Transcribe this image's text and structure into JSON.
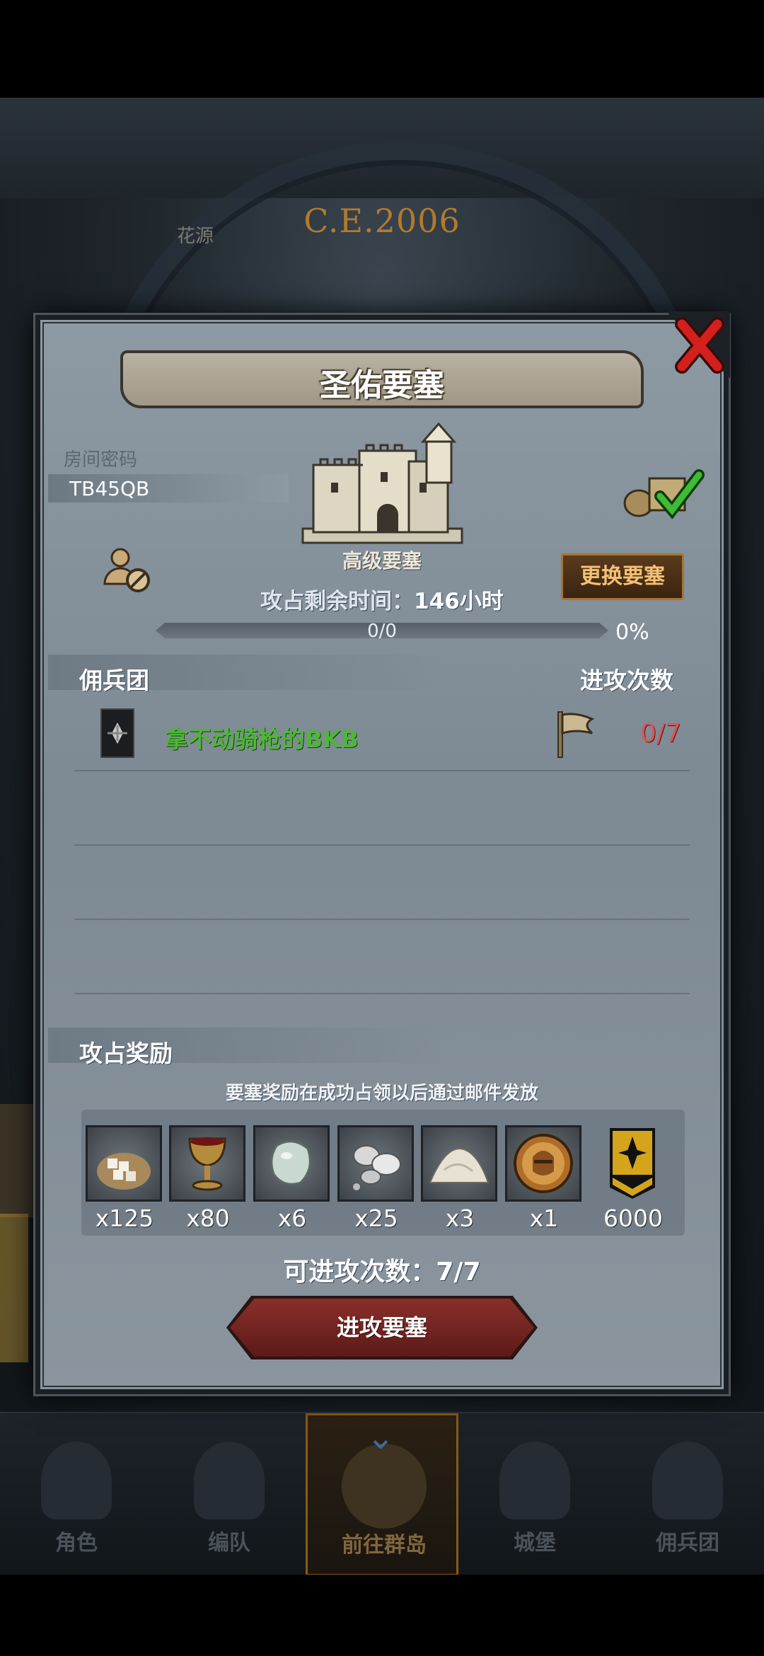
{
  "background": {
    "era_label": "C.E.2006",
    "map_text": "花源"
  },
  "modal": {
    "title": "圣佑要塞",
    "room_code_label": "房间密码",
    "room_code": "TB45QB",
    "fortress_tier": "高级要塞",
    "change_button": "更换要塞",
    "time_left_label": "攻占剩余时间：",
    "time_left_value": "146小时",
    "progress_text": "0/0",
    "progress_fraction": 0,
    "progress_percent": "0%",
    "mercenary_header": "佣兵团",
    "attacks_header": "进攻次数",
    "guilds": [
      {
        "name": "拿不动骑枪的BKB",
        "attacks": "0/7"
      }
    ],
    "reward_header": "攻占奖励",
    "reward_note": "要塞奖励在成功占领以后通过邮件发放",
    "rewards": [
      {
        "icon": "sugar-sack-icon",
        "qty": "x125"
      },
      {
        "icon": "goblet-icon",
        "qty": "x80"
      },
      {
        "icon": "gemstone-icon",
        "qty": "x6"
      },
      {
        "icon": "silver-ore-icon",
        "qty": "x25"
      },
      {
        "icon": "salt-pile-icon",
        "qty": "x3"
      },
      {
        "icon": "knight-medal-icon",
        "qty": "x1"
      },
      {
        "icon": "guild-banner-icon",
        "qty": "6000"
      }
    ],
    "attack_count_label": "可进攻次数：",
    "attack_count_value": "7/7",
    "attack_button": "进攻要塞"
  },
  "nav": [
    {
      "label": "角色",
      "icon": "character-icon"
    },
    {
      "label": "编队",
      "icon": "formation-icon"
    },
    {
      "label": "前往群岛",
      "icon": "islands-icon",
      "active": true
    },
    {
      "label": "城堡",
      "icon": "castle-icon"
    },
    {
      "label": "佣兵团",
      "icon": "mercenary-icon"
    }
  ],
  "colors": {
    "guild_name": "#4fb63a",
    "attacks_red": "#e05454",
    "change_button_text": "#f3c074",
    "attack_button": "#8a2f2b"
  }
}
